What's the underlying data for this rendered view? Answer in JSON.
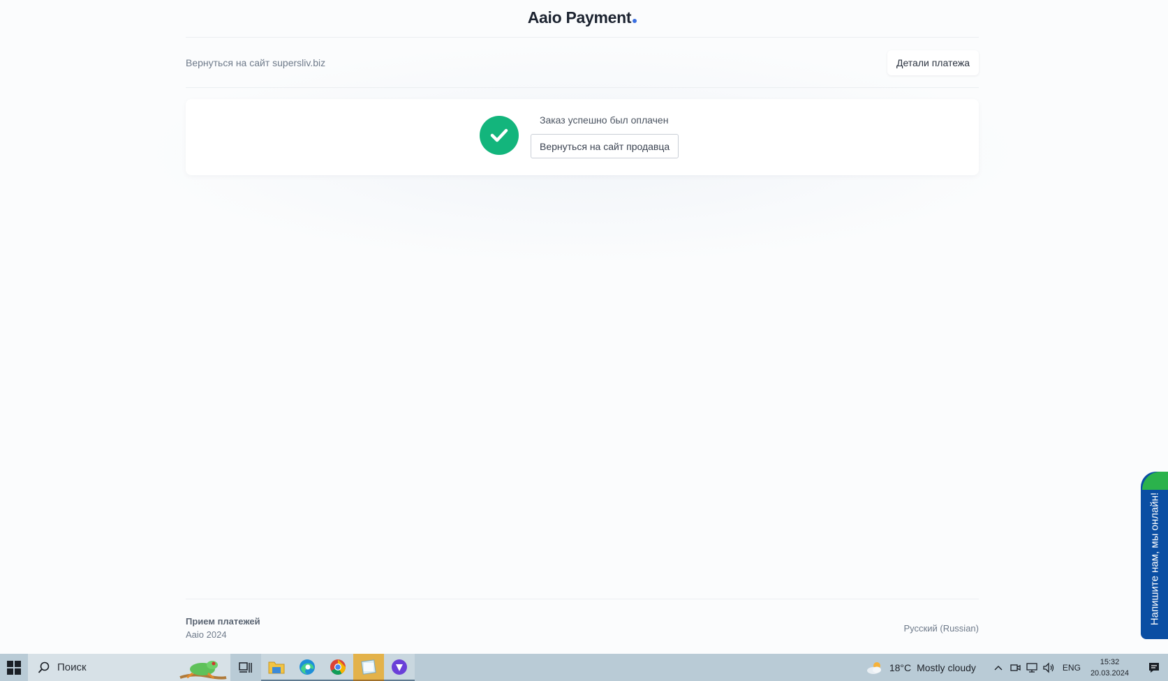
{
  "brand": {
    "name": "Aaio Payment"
  },
  "subheader": {
    "back_link": "Вернуться на сайт supersliv.biz",
    "details_button": "Детали платежа"
  },
  "status": {
    "message": "Заказ успешно был оплачен",
    "seller_button": "Вернуться на сайт продавца",
    "icon": "checkmark-icon",
    "color": "#13b57c"
  },
  "footer": {
    "title": "Прием платежей",
    "subtitle": "Aaio 2024",
    "language": "Русский (Russian)"
  },
  "chat_widget": {
    "label": "Напишите нам, мы онлайн!"
  },
  "taskbar": {
    "search_placeholder": "Поиск",
    "weather_temp": "18°C",
    "weather_text": "Mostly cloudy",
    "language": "ENG",
    "time": "15:32",
    "date": "20.03.2024"
  }
}
